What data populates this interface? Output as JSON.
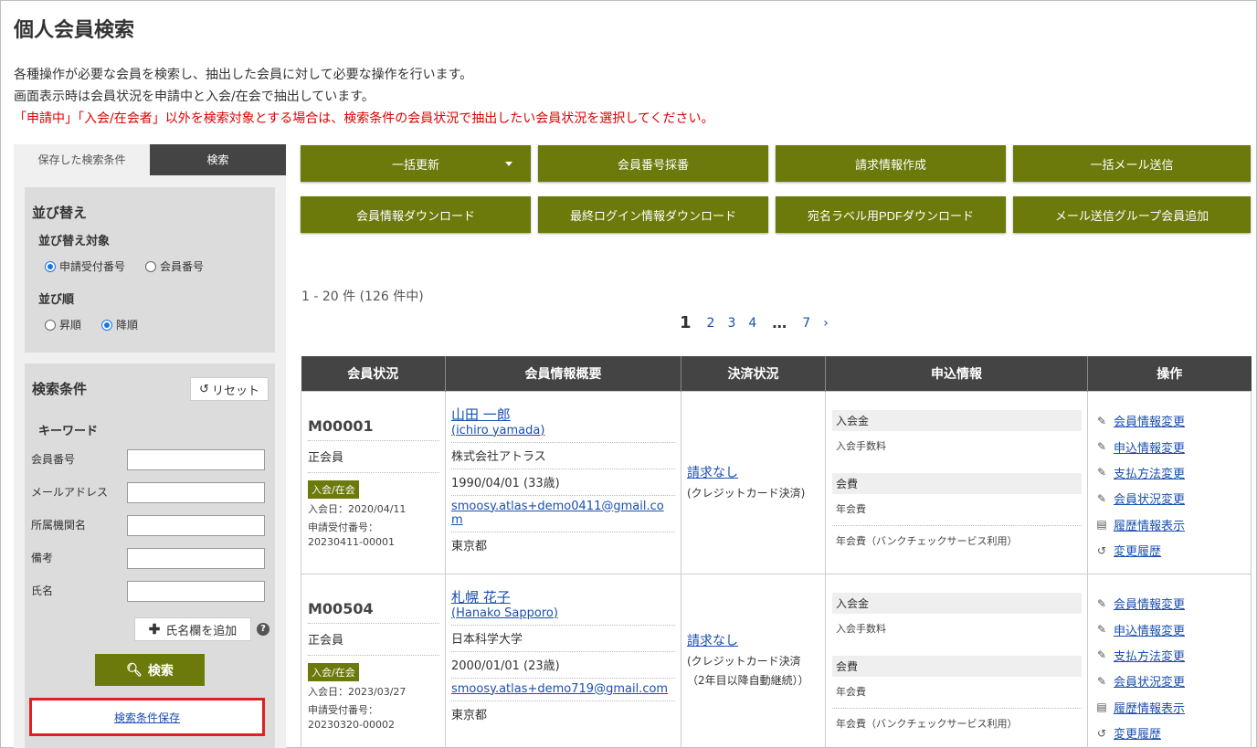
{
  "page": {
    "title": "個人会員検索",
    "desc1": "各種操作が必要な会員を検索し、抽出した会員に対して必要な操作を行います。",
    "desc2": "画面表示時は会員状況を申請中と入会/在会で抽出しています。",
    "desc3": "「申請中」「入会/在会者」以外を検索対象とする場合は、検索条件の会員状況で抽出したい会員状況を選択してください。"
  },
  "sidebar": {
    "tab_saved": "保存した検索条件",
    "tab_search": "検索",
    "sort": {
      "title": "並び替え",
      "target_label": "並び替え対象",
      "target_options": [
        "申請受付番号",
        "会員番号"
      ],
      "target_selected": "申請受付番号",
      "order_label": "並び順",
      "order_options": [
        "昇順",
        "降順"
      ],
      "order_selected": "降順"
    },
    "conditions": {
      "title": "検索条件",
      "reset_label": "リセット",
      "keyword_label": "キーワード",
      "fields": [
        "会員番号",
        "メールアドレス",
        "所属機関名",
        "備考",
        "氏名"
      ],
      "add_name_label": "氏名欄を追加",
      "search_label": "検索",
      "save_label": "検索条件保存"
    }
  },
  "actions": {
    "row1": [
      "一括更新",
      "会員番号採番",
      "請求情報作成",
      "一括メール送信"
    ],
    "row2": [
      "会員情報ダウンロード",
      "最終ログイン情報ダウンロード",
      "宛名ラベル用PDFダウンロード",
      "メール送信グループ会員追加"
    ]
  },
  "results": {
    "count_text": "1 - 20 件 (126 件中)",
    "pagination": {
      "current": "1",
      "pages": [
        "2",
        "3",
        "4"
      ],
      "dots": "…",
      "last": "7",
      "next": "›"
    }
  },
  "table": {
    "headers": [
      "会員状況",
      "会員情報概要",
      "決済状況",
      "申込情報",
      "操作"
    ],
    "rows": [
      {
        "member_no": "M00001",
        "member_type": "正会員",
        "status_badge": "入会/在会",
        "join_date": "入会日：2020/04/11",
        "app_no_label": "申請受付番号：",
        "app_no": "20230411-00001",
        "name": "山田 一郎",
        "name_roman": "(ichiro yamada)",
        "org": "株式会社アトラス",
        "birth": "1990/04/01 (33歳)",
        "email": "smoosy.atlas+demo0411@gmail.com",
        "pref": "東京都",
        "billing_link": "請求なし",
        "billing_note": "(クレジットカード決済)",
        "app_h1": "入会金",
        "app_i1": "入会手数料",
        "app_h2": "会費",
        "app_i2": "年会費",
        "app_i3": "年会費（バンクチェックサービス利用）"
      },
      {
        "member_no": "M00504",
        "member_type": "正会員",
        "status_badge": "入会/在会",
        "join_date": "入会日：2023/03/27",
        "app_no_label": "申請受付番号：",
        "app_no": "20230320-00002",
        "name": "札幌 花子",
        "name_roman": "(Hanako Sapporo)",
        "org": "日本科学大学",
        "birth": "2000/01/01 (23歳)",
        "email": "smoosy.atlas+demo719@gmail.com",
        "pref": "東京都",
        "billing_link": "請求なし",
        "billing_note": "(クレジットカード決済",
        "billing_note2": "（2年目以降自動継続））",
        "app_h1": "入会金",
        "app_i1": "入会手数料",
        "app_h2": "会費",
        "app_i2": "年会費",
        "app_i3": "年会費（バンクチェックサービス利用）"
      }
    ],
    "operations": [
      "会員情報変更",
      "申込情報変更",
      "支払方法変更",
      "会員状況変更",
      "履歴情報表示",
      "変更履歴"
    ]
  }
}
